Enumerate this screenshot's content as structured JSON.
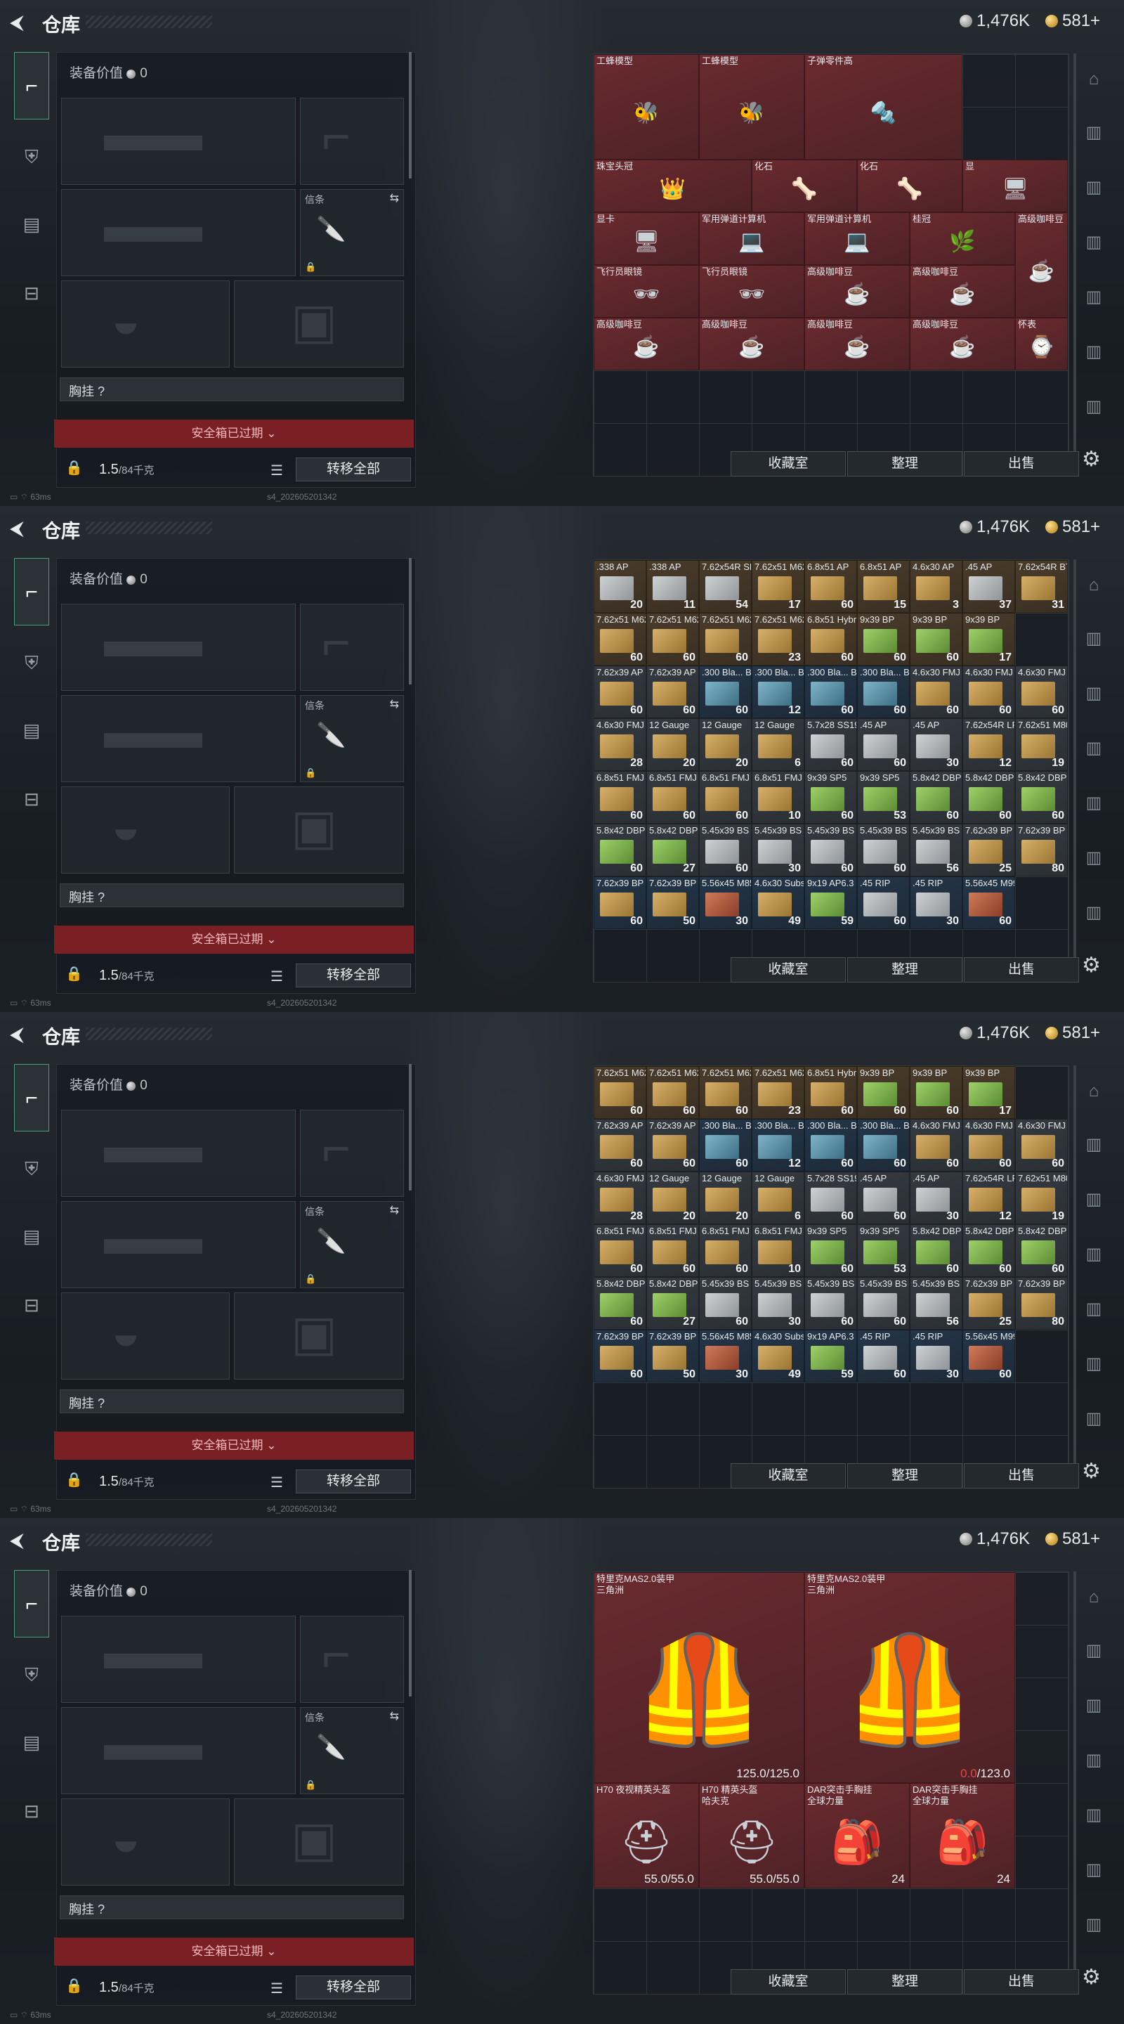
{
  "header": {
    "title": "仓库",
    "silver": "1,476K",
    "gold": "581+"
  },
  "left": {
    "equip_value_label": "装备价值",
    "equip_value": "0",
    "knife_label": "信条",
    "chest_label": "胸挂",
    "chest_q": "?",
    "expired": "安全箱已过期",
    "weight": "1.5",
    "weight_cap": "/84千克",
    "transfer": "转移全部"
  },
  "status": {
    "ping": "63ms",
    "build": "s4_202605201342"
  },
  "buttons": {
    "collect": "收藏室",
    "sort": "整理",
    "sell": "出售"
  },
  "colors": {
    "expired": "#7a1f24",
    "accent": "#4c9a7e",
    "low_durability": "#e14848"
  },
  "frame1_items": [
    {
      "name": "工蜂模型",
      "style": "red",
      "icon": "wasp-model"
    },
    {
      "name": "工蜂模型",
      "style": "red",
      "icon": "wasp-model"
    },
    {
      "name": "子弹零件高",
      "style": "red",
      "icon": "bullet-parts"
    },
    {
      "name": "珠宝头冠",
      "style": "red",
      "icon": "crown"
    },
    {
      "name": "化石",
      "style": "red",
      "icon": "fossil"
    },
    {
      "name": "化石",
      "style": "red",
      "icon": "fossil"
    },
    {
      "name": "显",
      "style": "red",
      "icon": "gpu"
    },
    {
      "name": "显卡",
      "style": "red",
      "icon": "gpu"
    },
    {
      "name": "军用弹道计算机",
      "style": "red",
      "icon": "computer"
    },
    {
      "name": "军用弹道计算机",
      "style": "red",
      "icon": "computer"
    },
    {
      "name": "桂冠",
      "style": "red",
      "icon": "laurel"
    },
    {
      "name": "高级咖啡豆",
      "style": "red",
      "icon": "coffee"
    },
    {
      "name": "飞行员眼镜",
      "style": "red",
      "icon": "glasses"
    },
    {
      "name": "飞行员眼镜",
      "style": "red",
      "icon": "glasses"
    },
    {
      "name": "高级咖啡豆",
      "style": "red",
      "icon": "coffee"
    },
    {
      "name": "高级咖啡豆",
      "style": "red",
      "icon": "coffee"
    },
    {
      "name": "高级咖啡豆",
      "style": "red",
      "icon": "coffee"
    },
    {
      "name": "高级咖啡豆",
      "style": "red",
      "icon": "coffee"
    },
    {
      "name": "高级咖啡豆",
      "style": "red",
      "icon": "coffee"
    },
    {
      "name": "高级咖啡豆",
      "style": "red",
      "icon": "coffee"
    },
    {
      "name": "怀表",
      "style": "red",
      "icon": "pocket-watch"
    }
  ],
  "ammo_rows": [
    [
      {
        "n": ".338 AP",
        "c": "20",
        "b": "ammo",
        "s": "brown"
      },
      {
        "n": ".338 AP",
        "c": "11",
        "b": "ammo",
        "s": "brown"
      },
      {
        "n": "7.62x54R SNB",
        "c": "54",
        "b": "ammo",
        "s": "brown"
      },
      {
        "n": "7.62x51 M62",
        "c": "17",
        "b": "tan",
        "s": "brown"
      },
      {
        "n": "6.8x51 AP",
        "c": "60",
        "b": "tan",
        "s": "brown"
      },
      {
        "n": "6.8x51 AP",
        "c": "15",
        "b": "tan",
        "s": "brown"
      },
      {
        "n": "4.6x30 AP",
        "c": "3",
        "b": "tan",
        "s": "brown"
      },
      {
        "n": ".45 AP",
        "c": "37",
        "b": "ammo",
        "s": "brown"
      },
      {
        "n": "7.62x54R BT",
        "c": "31",
        "b": "tan",
        "s": "brown"
      }
    ],
    [
      {
        "n": "7.62x51 M62",
        "c": "60",
        "b": "tan",
        "s": "brown"
      },
      {
        "n": "7.62x51 M62",
        "c": "60",
        "b": "tan",
        "s": "brown"
      },
      {
        "n": "7.62x51 M62",
        "c": "60",
        "b": "tan",
        "s": "brown"
      },
      {
        "n": "7.62x51 M62",
        "c": "23",
        "b": "tan",
        "s": "brown"
      },
      {
        "n": "6.8x51 Hybrid",
        "c": "60",
        "b": "tan",
        "s": "brown"
      },
      {
        "n": "9x39 BP",
        "c": "60",
        "b": "greenbox",
        "s": "brown"
      },
      {
        "n": "9x39 BP",
        "c": "60",
        "b": "greenbox",
        "s": "brown"
      },
      {
        "n": "9x39 BP",
        "c": "17",
        "b": "greenbox",
        "s": "brown"
      }
    ],
    [
      {
        "n": "7.62x39 AP",
        "c": "60",
        "b": "tan",
        "s": "gray"
      },
      {
        "n": "7.62x39 AP",
        "c": "60",
        "b": "tan",
        "s": "gray"
      },
      {
        "n": ".300 Bla... BCP FMJ",
        "c": "60",
        "b": "bluebox",
        "s": "navy"
      },
      {
        "n": ".300 Bla... BCP FMJ",
        "c": "12",
        "b": "bluebox",
        "s": "navy"
      },
      {
        "n": ".300 Bla... BCP FMJ",
        "c": "60",
        "b": "bluebox",
        "s": "navy"
      },
      {
        "n": ".300 Bla... BCP FMJ",
        "c": "60",
        "b": "bluebox",
        "s": "navy"
      },
      {
        "n": "4.6x30 FMJ",
        "c": "60",
        "b": "tan",
        "s": "gray"
      },
      {
        "n": "4.6x30 FMJ",
        "c": "60",
        "b": "tan",
        "s": "gray"
      },
      {
        "n": "4.6x30 FMJ",
        "c": "60",
        "b": "tan",
        "s": "gray"
      }
    ],
    [
      {
        "n": "4.6x30 FMJ",
        "c": "28",
        "b": "tan",
        "s": "gray"
      },
      {
        "n": "12 Gauge",
        "c": "20",
        "b": "tan",
        "s": "gray"
      },
      {
        "n": "12 Gauge",
        "c": "20",
        "b": "tan",
        "s": "gray"
      },
      {
        "n": "12 Gauge",
        "c": "6",
        "b": "tan",
        "s": "gray"
      },
      {
        "n": "5.7x28 SS190",
        "c": "60",
        "b": "ammo",
        "s": "gray"
      },
      {
        "n": ".45 AP",
        "c": "60",
        "b": "ammo",
        "s": "gray"
      },
      {
        "n": ".45 AP",
        "c": "30",
        "b": "ammo",
        "s": "gray"
      },
      {
        "n": "7.62x54R LPS",
        "c": "12",
        "b": "tan",
        "s": "gray"
      },
      {
        "n": "7.62x51 M80",
        "c": "19",
        "b": "tan",
        "s": "gray"
      }
    ],
    [
      {
        "n": "6.8x51 FMJ",
        "c": "60",
        "b": "tan",
        "s": "gray"
      },
      {
        "n": "6.8x51 FMJ",
        "c": "60",
        "b": "tan",
        "s": "gray"
      },
      {
        "n": "6.8x51 FMJ",
        "c": "60",
        "b": "tan",
        "s": "gray"
      },
      {
        "n": "6.8x51 FMJ",
        "c": "10",
        "b": "tan",
        "s": "gray"
      },
      {
        "n": "9x39 SP5",
        "c": "60",
        "b": "greenbox",
        "s": "gray"
      },
      {
        "n": "9x39 SP5",
        "c": "53",
        "b": "greenbox",
        "s": "gray"
      },
      {
        "n": "5.8x42 DBP10",
        "c": "60",
        "b": "greenbox",
        "s": "gray"
      },
      {
        "n": "5.8x42 DBP10",
        "c": "60",
        "b": "greenbox",
        "s": "gray"
      },
      {
        "n": "5.8x42 DBP10",
        "c": "60",
        "b": "greenbox",
        "s": "gray"
      }
    ],
    [
      {
        "n": "5.8x42 DBP10",
        "c": "60",
        "b": "greenbox",
        "s": "gray"
      },
      {
        "n": "5.8x42 DBP10",
        "c": "27",
        "b": "greenbox",
        "s": "gray"
      },
      {
        "n": "5.45x39 BS",
        "c": "60",
        "b": "ammo",
        "s": "gray"
      },
      {
        "n": "5.45x39 BS",
        "c": "30",
        "b": "ammo",
        "s": "gray"
      },
      {
        "n": "5.45x39 BS",
        "c": "60",
        "b": "ammo",
        "s": "gray"
      },
      {
        "n": "5.45x39 BS",
        "c": "60",
        "b": "ammo",
        "s": "gray"
      },
      {
        "n": "5.45x39 BS",
        "c": "56",
        "b": "ammo",
        "s": "gray"
      },
      {
        "n": "7.62x39 BP",
        "c": "25",
        "b": "tan",
        "s": "gray"
      },
      {
        "n": "7.62x39 BP",
        "c": "80",
        "b": "tan",
        "s": "gray"
      }
    ],
    [
      {
        "n": "7.62x39 BP",
        "c": "60",
        "b": "tan",
        "s": "navy"
      },
      {
        "n": "7.62x39 BP",
        "c": "50",
        "b": "tan",
        "s": "navy"
      },
      {
        "n": "5.56x45 M855A1",
        "c": "30",
        "b": "redbox",
        "s": "navy"
      },
      {
        "n": "4.6x30 Subsonic",
        "c": "49",
        "b": "tan",
        "s": "navy"
      },
      {
        "n": "9x19 AP6.3",
        "c": "59",
        "b": "greenbox",
        "s": "navy"
      },
      {
        "n": ".45 RIP",
        "c": "60",
        "b": "ammo",
        "s": "navy"
      },
      {
        "n": ".45 RIP",
        "c": "30",
        "b": "ammo",
        "s": "navy"
      },
      {
        "n": "5.56x45 M995",
        "c": "60",
        "b": "redbox",
        "s": "navy"
      }
    ]
  ],
  "frame4_items": [
    {
      "name": "特里克MAS2.0装甲",
      "sub": "三角洲",
      "dur": "125.0",
      "max": "/125.0",
      "lo": false,
      "icon": "armor-vest"
    },
    {
      "name": "特里克MAS2.0装甲",
      "sub": "三角洲",
      "dur": "0.0",
      "max": "/123.0",
      "lo": true,
      "icon": "armor-vest"
    },
    {
      "name": "H70 夜视精英头盔",
      "sub": "",
      "dur": "55.0/55.0",
      "icon": "nvg-helmet"
    },
    {
      "name": "H70 精英头盔",
      "sub": "哈夫克",
      "dur": "55.0/55.0",
      "icon": "helmet"
    },
    {
      "name": "DAR突击手胸挂",
      "sub": "全球力量",
      "dur": "24",
      "icon": "chest-rig"
    },
    {
      "name": "DAR突击手胸挂",
      "sub": "全球力量",
      "dur": "24",
      "icon": "chest-rig"
    }
  ]
}
